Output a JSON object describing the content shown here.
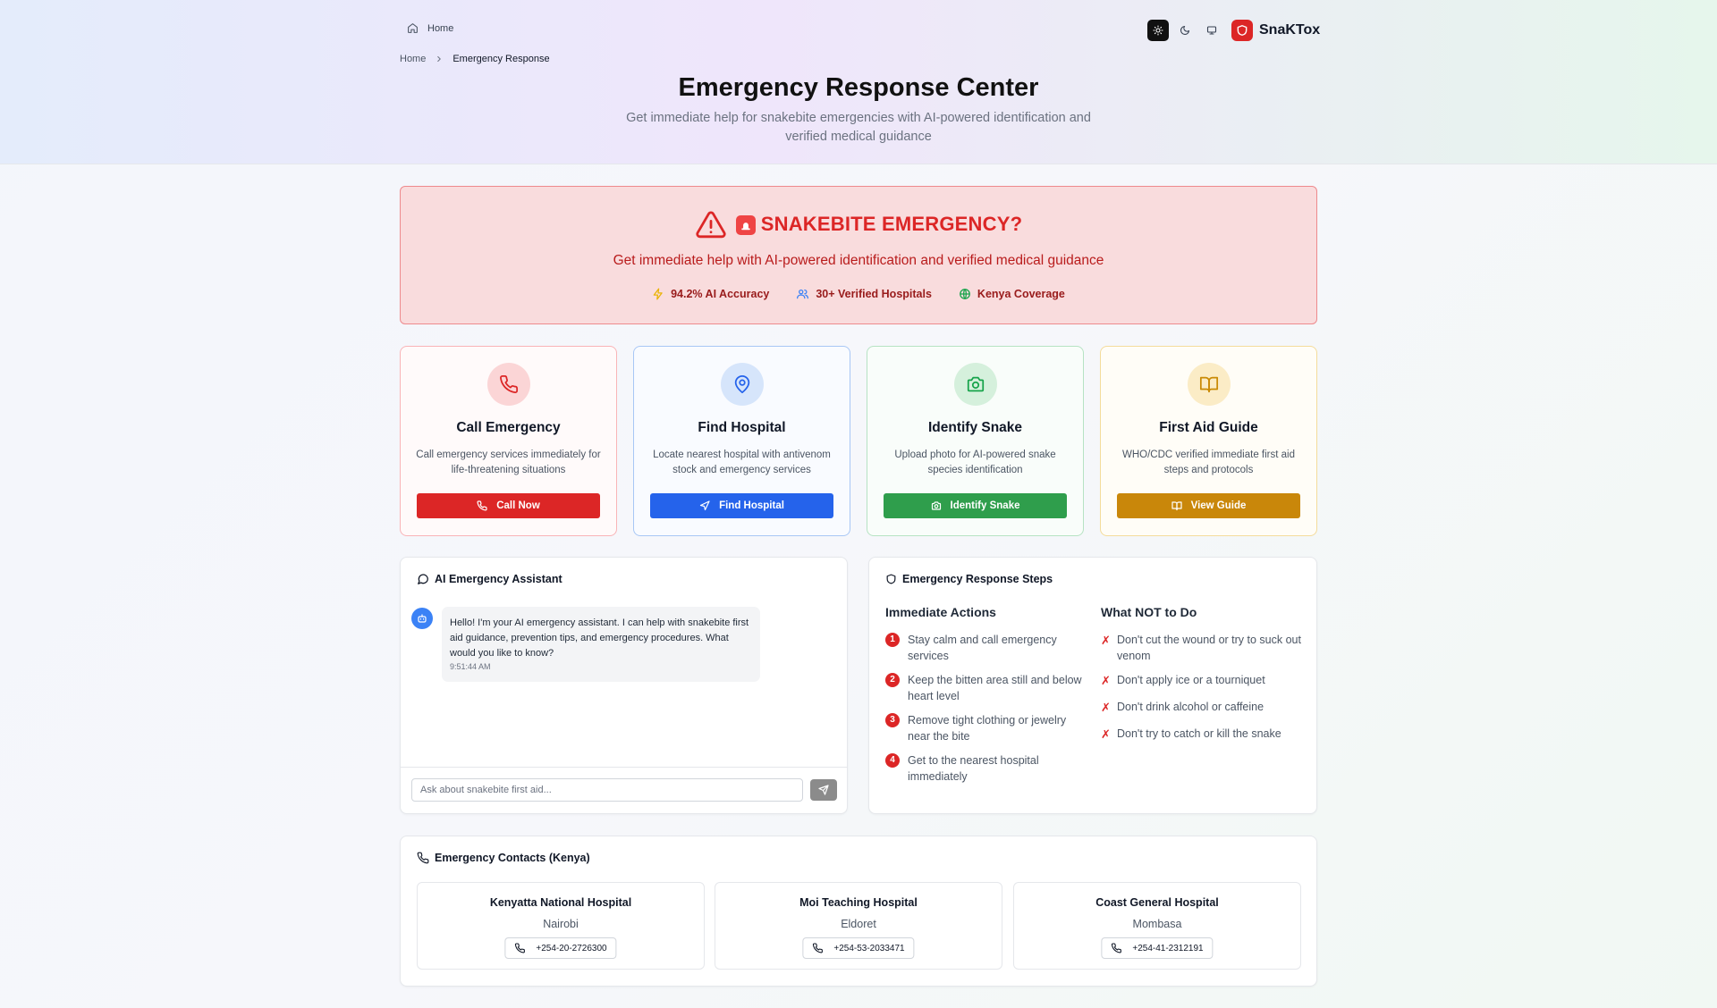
{
  "nav": {
    "home_label": "Home",
    "brand_name": "SnaKTox",
    "theme_toggles": [
      "sun-icon",
      "moon-icon",
      "monitor-icon"
    ]
  },
  "breadcrumb": {
    "home": "Home",
    "current": "Emergency Response"
  },
  "hero": {
    "title": "Emergency Response Center",
    "subtitle": "Get immediate help for snakebite emergencies with AI-powered identification and verified medical guidance"
  },
  "alert": {
    "title": "SNAKEBITE EMERGENCY?",
    "subtitle": "Get immediate help with AI-powered identification and verified medical guidance",
    "stats": [
      "94.2% AI Accuracy",
      "30+ Verified Hospitals",
      "Kenya Coverage"
    ]
  },
  "actions": [
    {
      "title": "Call Emergency",
      "description": "Call emergency services immediately for life-threatening situations",
      "button": "Call Now",
      "icon": "phone-icon",
      "color": "#dc2626"
    },
    {
      "title": "Find Hospital",
      "description": "Locate nearest hospital with antivenom stock and emergency services",
      "button": "Find Hospital",
      "icon": "map-pin-icon",
      "color": "#2563eb"
    },
    {
      "title": "Identify Snake",
      "description": "Upload photo for AI-powered snake species identification",
      "button": "Identify Snake",
      "icon": "camera-icon",
      "color": "#16a34a"
    },
    {
      "title": "First Aid Guide",
      "description": "WHO/CDC verified immediate first aid steps and protocols",
      "button": "View Guide",
      "icon": "book-icon",
      "color": "#ca8a04"
    }
  ],
  "assistant": {
    "title": "AI Emergency Assistant",
    "message": "Hello! I'm your AI emergency assistant. I can help with snakebite first aid guidance, prevention tips, and emergency procedures. What would you like to know?",
    "time": "9:51:44 AM",
    "input_placeholder": "Ask about snakebite first aid..."
  },
  "steps": {
    "title": "Emergency Response Steps",
    "immediate_title": "Immediate Actions",
    "immediate": [
      "Stay calm and call emergency services",
      "Keep the bitten area still and below heart level",
      "Remove tight clothing or jewelry near the bite",
      "Get to the nearest hospital immediately"
    ],
    "dont_title": "What NOT to Do",
    "dont": [
      "Don't cut the wound or try to suck out venom",
      "Don't apply ice or a tourniquet",
      "Don't drink alcohol or caffeine",
      "Don't try to catch or kill the snake"
    ]
  },
  "contacts": {
    "title": "Emergency Contacts (Kenya)",
    "hospitals": [
      {
        "name": "Kenyatta National Hospital",
        "city": "Nairobi",
        "phone": "+254-20-2726300"
      },
      {
        "name": "Moi Teaching Hospital",
        "city": "Eldoret",
        "phone": "+254-53-2033471"
      },
      {
        "name": "Coast General Hospital",
        "city": "Mombasa",
        "phone": "+254-41-2312191"
      }
    ]
  }
}
